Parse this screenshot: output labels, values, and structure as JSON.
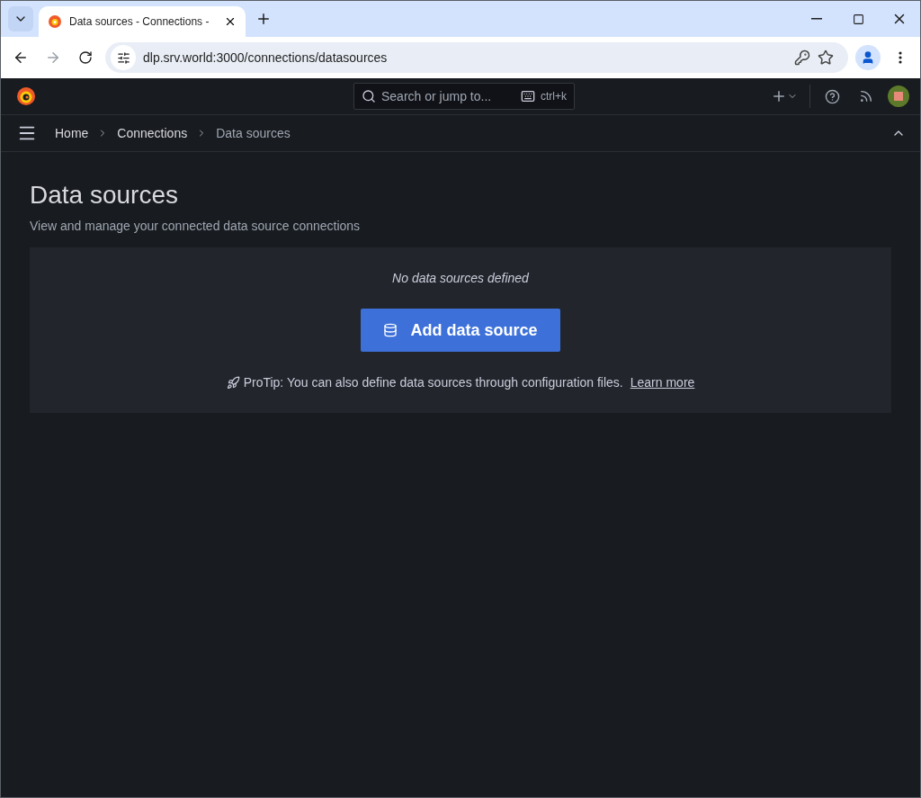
{
  "browser": {
    "tab_title": "Data sources - Connections -",
    "url": "dlp.srv.world:3000/connections/datasources"
  },
  "topbar": {
    "search_placeholder": "Search or jump to...",
    "shortcut": "ctrl+k"
  },
  "breadcrumbs": [
    {
      "label": "Home",
      "selected": false
    },
    {
      "label": "Connections",
      "selected": false
    },
    {
      "label": "Data sources",
      "selected": true
    }
  ],
  "page": {
    "title": "Data sources",
    "subtitle": "View and manage your connected data source connections"
  },
  "empty_state": {
    "message": "No data sources defined",
    "button": "Add data source",
    "tip": "ProTip: You can also define data sources through configuration files.",
    "link": "Learn more"
  }
}
